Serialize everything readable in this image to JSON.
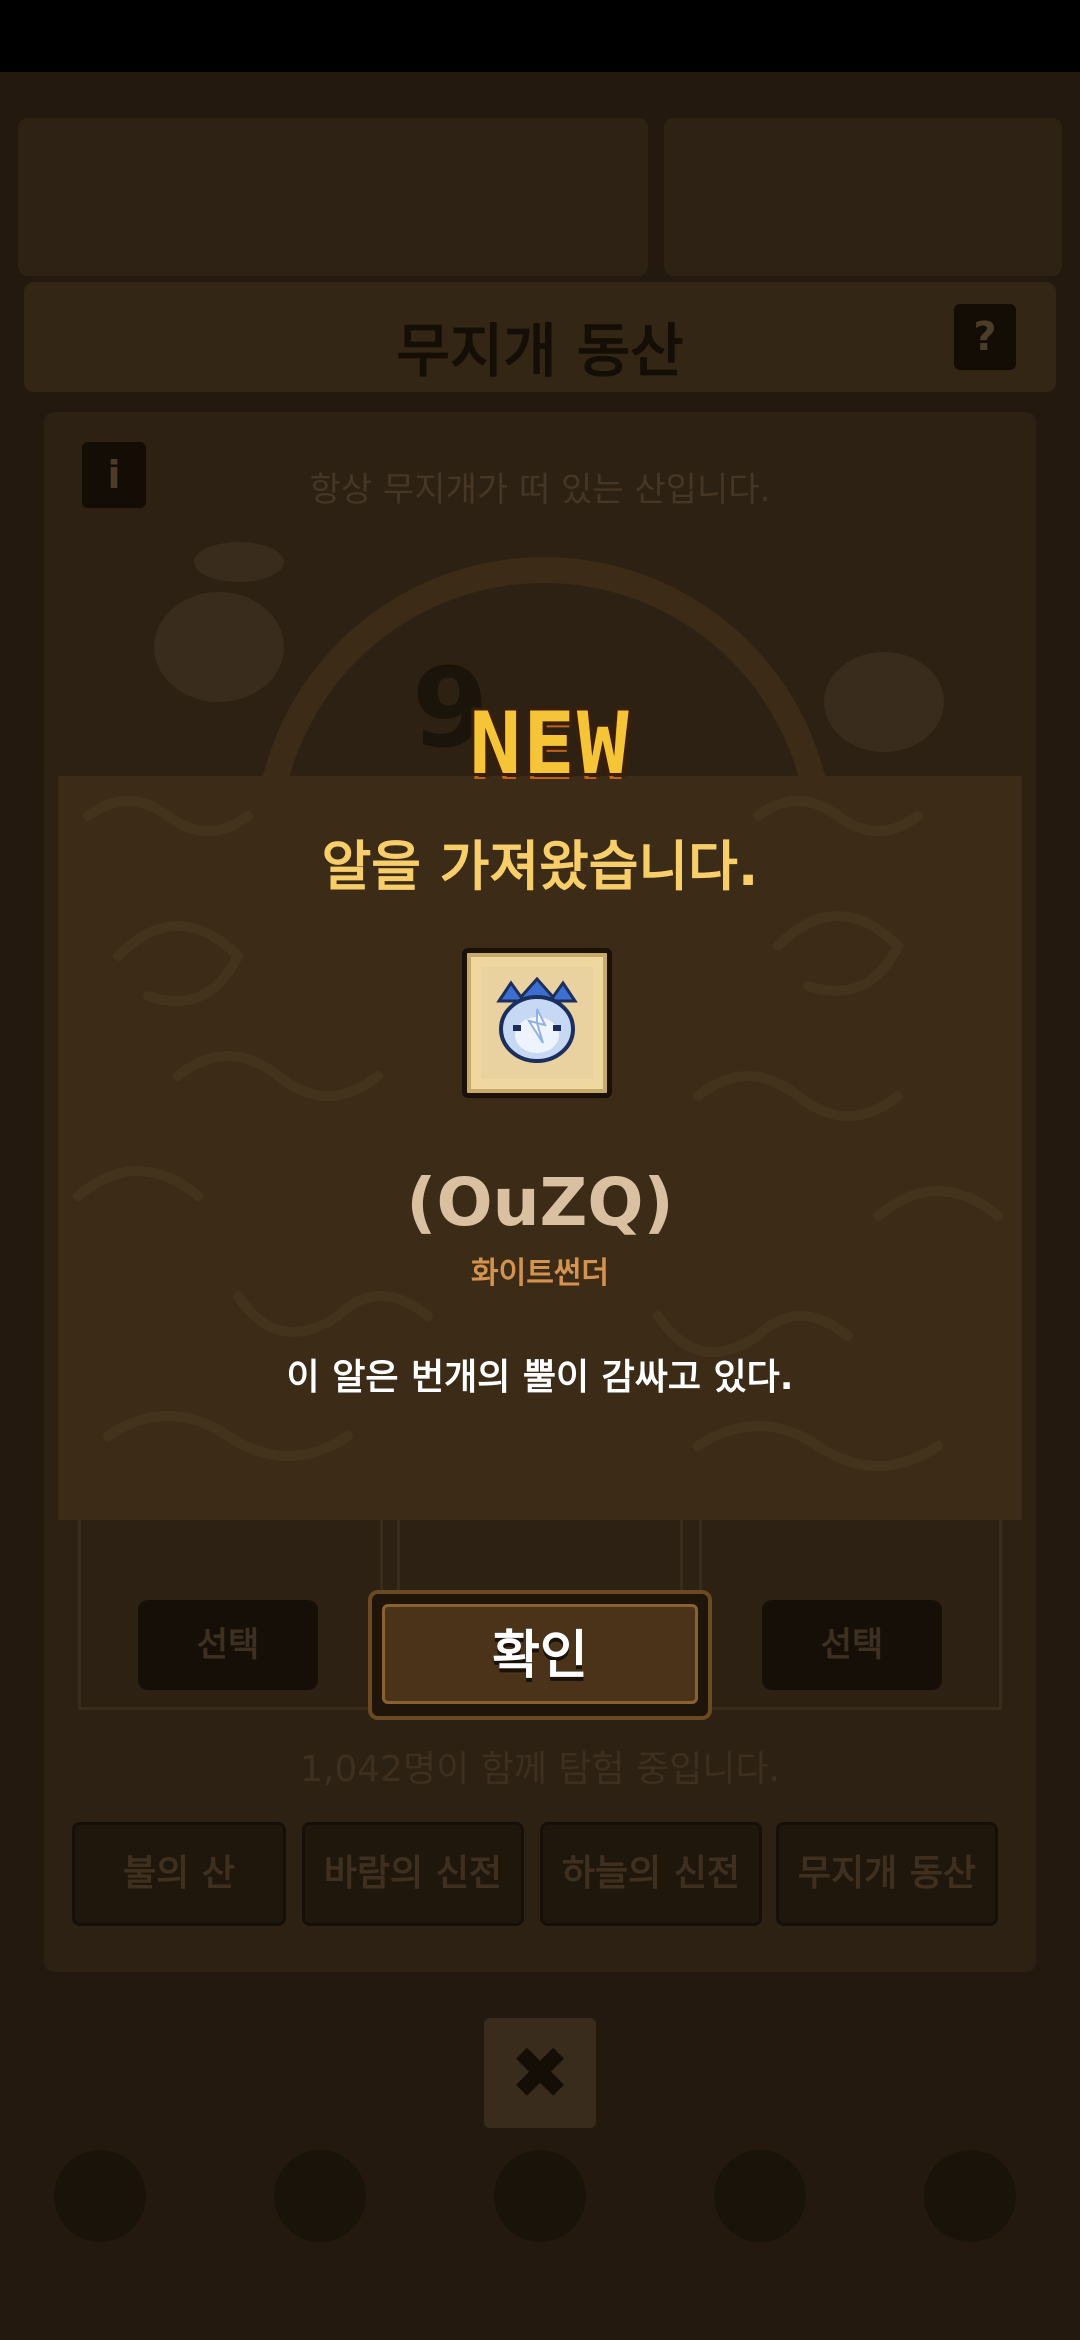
{
  "background": {
    "title": "무지개 동산",
    "help_label": "?",
    "info_label": "i",
    "description": "항상 무지개가 떠 있는 산입니다.",
    "slot_number": "9",
    "select_left": "선택",
    "select_right": "선택",
    "player_count": "1,042명이 함께 탐험 중입니다.",
    "tabs": [
      {
        "label": "불의 산"
      },
      {
        "label": "바람의 신전"
      },
      {
        "label": "하늘의 신전"
      },
      {
        "label": "무지개 동산"
      }
    ],
    "close_label": "✖"
  },
  "modal": {
    "badge": "NEW",
    "headline": "알을 가져왔습니다.",
    "egg_code": "(OuZQ)",
    "egg_name": "화이트썬더",
    "description": "이 알은 번개의 뿔이 감싸고 있다.",
    "confirm_label": "확인"
  },
  "colors": {
    "accent_gold": "#f7ce6a",
    "egg_name": "#d49450",
    "modal_bg": "#3b2b17"
  }
}
